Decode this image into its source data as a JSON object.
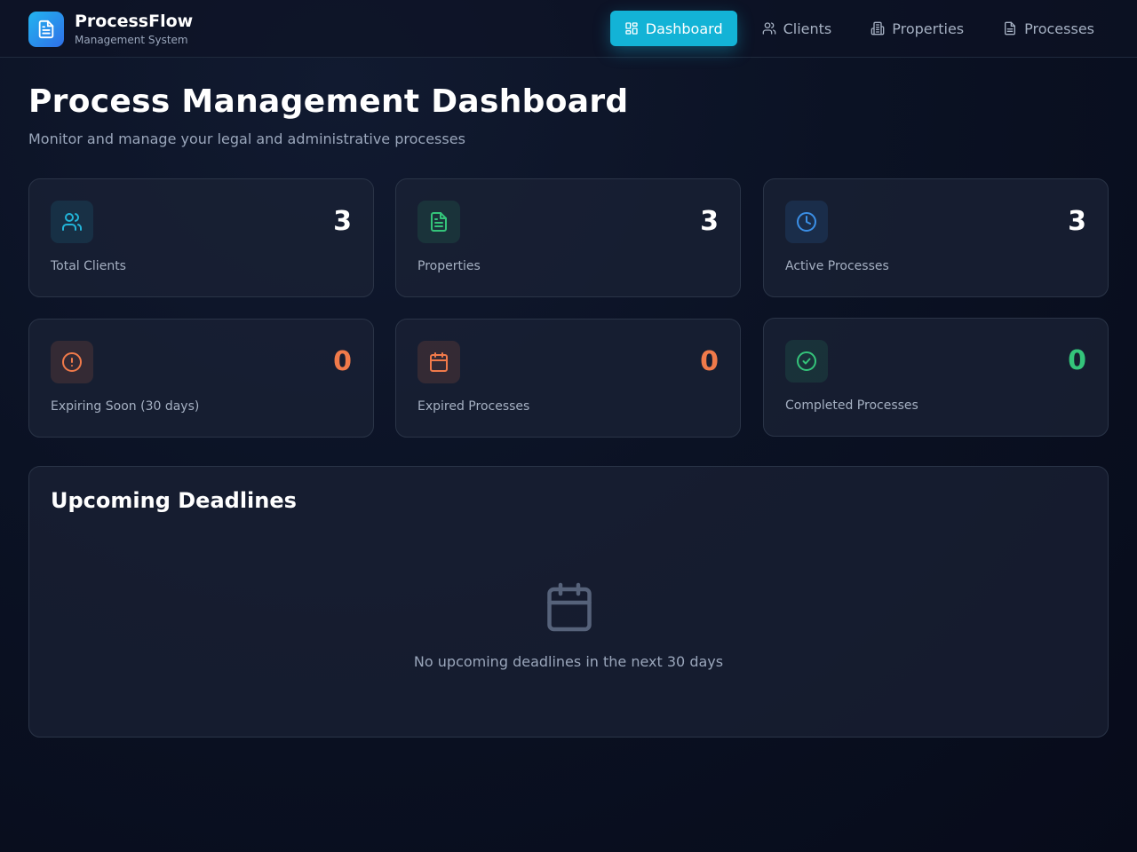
{
  "header": {
    "brand_title": "ProcessFlow",
    "brand_subtitle": "Management System",
    "brand_icon": "document-icon",
    "nav": [
      {
        "label": "Dashboard",
        "icon": "grid-icon",
        "active": true
      },
      {
        "label": "Clients",
        "icon": "users-icon",
        "active": false
      },
      {
        "label": "Properties",
        "icon": "building-icon",
        "active": false
      },
      {
        "label": "Processes",
        "icon": "file-icon",
        "active": false
      }
    ]
  },
  "page": {
    "title": "Process Management Dashboard",
    "subtitle": "Monitor and manage your legal and administrative processes"
  },
  "stats": [
    {
      "label": "Total Clients",
      "value": "3",
      "icon": "users-icon",
      "color": "#22b4d8"
    },
    {
      "label": "Properties",
      "value": "3",
      "icon": "document-icon",
      "color": "#34c47a"
    },
    {
      "label": "Active Processes",
      "value": "3",
      "icon": "clock-icon",
      "color": "#3b8fe6"
    },
    {
      "label": "Expiring Soon (30 days)",
      "value": "0",
      "icon": "alert-circle-icon",
      "color": "#f07a4a"
    },
    {
      "label": "Expired Processes",
      "value": "0",
      "icon": "calendar-icon",
      "color": "#f07a4a"
    },
    {
      "label": "Completed Processes",
      "value": "0",
      "icon": "check-circle-icon",
      "color": "#34c47a"
    }
  ],
  "deadlines": {
    "title": "Upcoming Deadlines",
    "empty_icon": "calendar-icon",
    "empty_text": "No upcoming deadlines in the next 30 days"
  }
}
